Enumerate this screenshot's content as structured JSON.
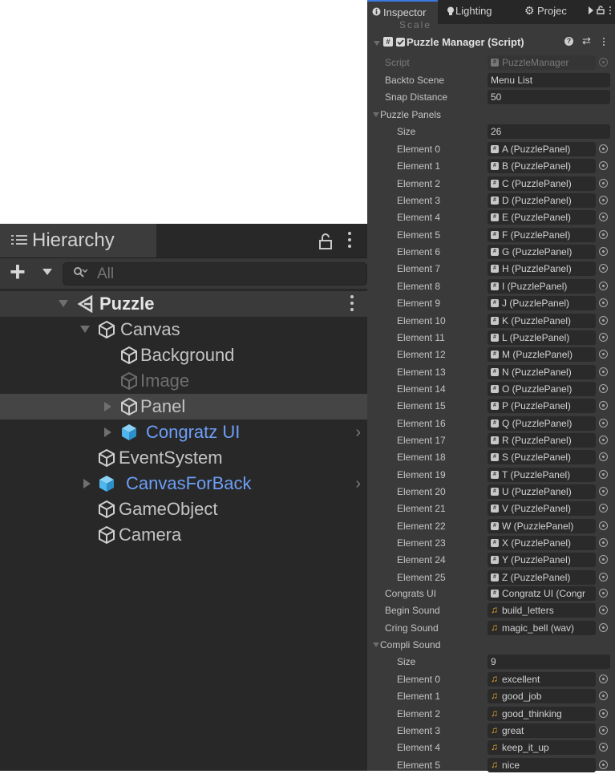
{
  "hierarchy": {
    "tab_label": "Hierarchy",
    "search": {
      "placeholder": "All"
    },
    "items": [
      {
        "name": "Puzzle",
        "kind": "scene"
      },
      {
        "name": "Canvas"
      },
      {
        "name": "Background"
      },
      {
        "name": "Image",
        "inactive": true
      },
      {
        "name": "Panel"
      },
      {
        "name": "Congratz UI",
        "prefab": true
      },
      {
        "name": "EventSystem"
      },
      {
        "name": "CanvasForBack",
        "prefab": true
      },
      {
        "name": "GameObject"
      },
      {
        "name": "Camera"
      }
    ],
    "colors": {
      "prefab_text": "#6d9ef7",
      "prefab_icon": "#4fb7ee",
      "inactive_text": "#6e6e6e"
    }
  },
  "inspector": {
    "tabs": [
      {
        "label": "Inspector",
        "icon": "info-icon"
      },
      {
        "label": "Lighting",
        "icon": "bulb-icon"
      },
      {
        "label": "Projec",
        "icon": "gear-icon"
      }
    ],
    "ghost_text": "Scale",
    "component": {
      "title": "Puzzle Manager (Script)",
      "enabled": true
    },
    "fields": {
      "script": {
        "label": "Script",
        "value": "PuzzleManager"
      },
      "backto_scene": {
        "label": "Backto Scene",
        "value": "Menu List"
      },
      "snap_distance": {
        "label": "Snap Distance",
        "value": "50"
      },
      "puzzle_panels": {
        "label": "Puzzle Panels",
        "size_label": "Size",
        "size": "26",
        "elements": [
          {
            "label": "Element 0",
            "value": "A (PuzzlePanel)"
          },
          {
            "label": "Element 1",
            "value": "B (PuzzlePanel)"
          },
          {
            "label": "Element 2",
            "value": "C (PuzzlePanel)"
          },
          {
            "label": "Element 3",
            "value": "D (PuzzlePanel)"
          },
          {
            "label": "Element 4",
            "value": "E (PuzzlePanel)"
          },
          {
            "label": "Element 5",
            "value": "F (PuzzlePanel)"
          },
          {
            "label": "Element 6",
            "value": "G (PuzzlePanel)"
          },
          {
            "label": "Element 7",
            "value": "H (PuzzlePanel)"
          },
          {
            "label": "Element 8",
            "value": "I (PuzzlePanel)"
          },
          {
            "label": "Element 9",
            "value": "J (PuzzlePanel)"
          },
          {
            "label": "Element 10",
            "value": "K (PuzzlePanel)"
          },
          {
            "label": "Element 11",
            "value": "L (PuzzlePanel)"
          },
          {
            "label": "Element 12",
            "value": "M (PuzzlePanel)"
          },
          {
            "label": "Element 13",
            "value": "N (PuzzlePanel)"
          },
          {
            "label": "Element 14",
            "value": "O (PuzzlePanel)"
          },
          {
            "label": "Element 15",
            "value": "P (PuzzlePanel)"
          },
          {
            "label": "Element 16",
            "value": "Q (PuzzlePanel)"
          },
          {
            "label": "Element 17",
            "value": "R (PuzzlePanel)"
          },
          {
            "label": "Element 18",
            "value": "S (PuzzlePanel)"
          },
          {
            "label": "Element 19",
            "value": "T (PuzzlePanel)"
          },
          {
            "label": "Element 20",
            "value": "U (PuzzlePanel)"
          },
          {
            "label": "Element 21",
            "value": "V (PuzzlePanel)"
          },
          {
            "label": "Element 22",
            "value": "W (PuzzlePanel)"
          },
          {
            "label": "Element 23",
            "value": "X (PuzzlePanel)"
          },
          {
            "label": "Element 24",
            "value": "Y (PuzzlePanel)"
          },
          {
            "label": "Element 25",
            "value": "Z (PuzzlePanel)"
          }
        ]
      },
      "congrats_ui": {
        "label": "Congrats UI",
        "value": "Congratz UI (Congr"
      },
      "begin_sound": {
        "label": "Begin Sound",
        "value": "build_letters"
      },
      "cring_sound": {
        "label": "Cring Sound",
        "value": "magic_bell (wav)"
      },
      "compli_sound": {
        "label": "Compli Sound",
        "size_label": "Size",
        "size": "9",
        "elements": [
          {
            "label": "Element 0",
            "value": "excellent"
          },
          {
            "label": "Element 1",
            "value": "good_job"
          },
          {
            "label": "Element 2",
            "value": "good_thinking"
          },
          {
            "label": "Element 3",
            "value": "great"
          },
          {
            "label": "Element 4",
            "value": "keep_it_up"
          },
          {
            "label": "Element 5",
            "value": "nice"
          }
        ]
      }
    },
    "colors": {
      "accent": "#3b7ae0",
      "audio_icon": "#e5a92a"
    }
  }
}
